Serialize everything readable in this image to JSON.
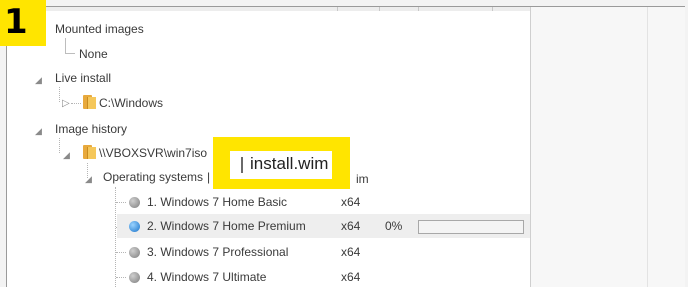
{
  "badge": {
    "number": "1"
  },
  "tree": {
    "mounted_images": {
      "label": "Mounted images",
      "child": "None"
    },
    "live_install": {
      "label": "Live install",
      "child": "C:\\Windows"
    },
    "image_history": {
      "label": "Image history",
      "source": "\\\\VBOXSVR\\win7iso",
      "operating_systems": {
        "label": "Operating systems",
        "separator": "|",
        "column_tail": "im"
      },
      "images": [
        {
          "name": "1. Windows 7 Home Basic",
          "arch": "x64",
          "status": "gray"
        },
        {
          "name": "2. Windows 7 Home Premium",
          "arch": "x64",
          "status": "blue",
          "progress_text": "0%",
          "progress": 0,
          "selected": true
        },
        {
          "name": "3. Windows 7 Professional",
          "arch": "x64",
          "status": "gray"
        },
        {
          "name": "4. Windows 7 Ultimate",
          "arch": "x64",
          "status": "gray"
        }
      ]
    }
  },
  "callout": {
    "text": "install.wim"
  },
  "colors": {
    "highlight": "#ffe500",
    "progress_fill": "#3daa47",
    "status_blue": "#1a73c9"
  },
  "icons": {
    "folder": "folder-icon",
    "collapse": "collapse-arrow-icon",
    "expand": "expand-arrow-icon",
    "status": "status-dot-icon"
  }
}
